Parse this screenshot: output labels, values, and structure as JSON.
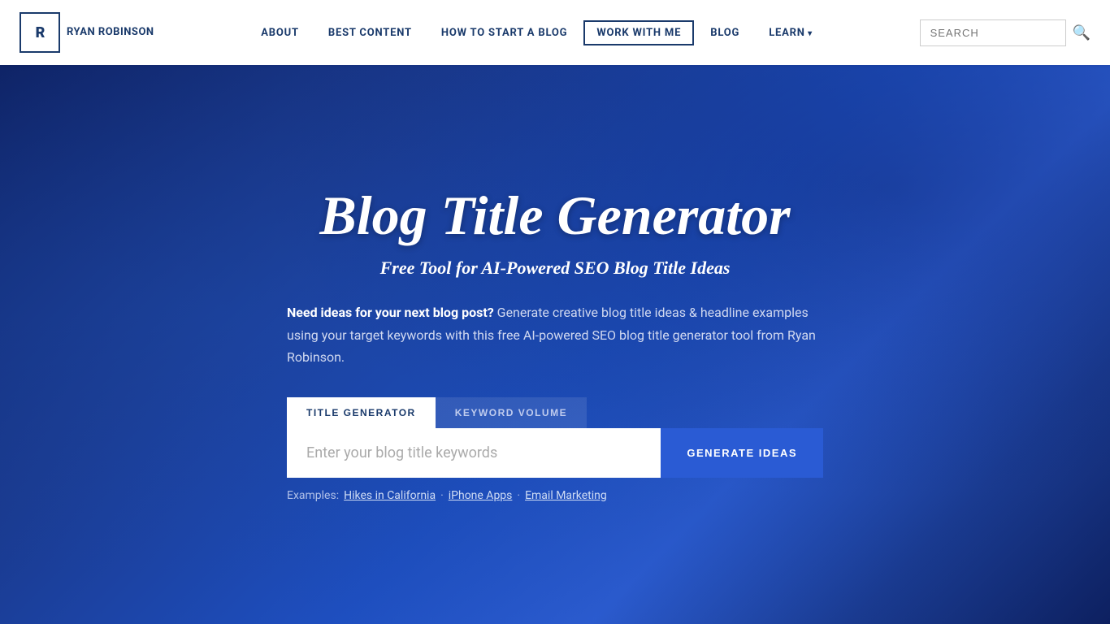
{
  "header": {
    "logo": {
      "initials": "R",
      "brand_name": "RYAN ROBINSON"
    },
    "nav": {
      "items": [
        {
          "id": "about",
          "label": "ABOUT",
          "active": false,
          "has_arrow": false
        },
        {
          "id": "best-content",
          "label": "BEST CONTENT",
          "active": false,
          "has_arrow": false
        },
        {
          "id": "how-to-start-a-blog",
          "label": "HOW TO START A BLOG",
          "active": false,
          "has_arrow": false
        },
        {
          "id": "work-with-me",
          "label": "WORK WITH ME",
          "active": true,
          "has_arrow": false
        },
        {
          "id": "blog",
          "label": "BLOG",
          "active": false,
          "has_arrow": false
        },
        {
          "id": "learn",
          "label": "LEARN",
          "active": false,
          "has_arrow": true
        }
      ]
    },
    "search": {
      "placeholder": "SEARCH"
    }
  },
  "hero": {
    "title": "Blog Title Generator",
    "subtitle": "Free Tool for AI-Powered SEO Blog Title Ideas",
    "description_bold": "Need ideas for your next blog post?",
    "description_text": " Generate creative blog title ideas & headline examples using your target keywords with this free AI-powered SEO blog title generator tool from Ryan Robinson.",
    "tabs": [
      {
        "id": "title-generator",
        "label": "TITLE GENERATOR",
        "active": true
      },
      {
        "id": "keyword-volume",
        "label": "KEYWORD VOLUME",
        "active": false
      }
    ],
    "input": {
      "placeholder": "Enter your blog title keywords"
    },
    "generate_button": "GENERATE IDEAS",
    "examples": {
      "label": "Examples:",
      "items": [
        {
          "text": "Hikes in California",
          "separator": ""
        },
        {
          "text": "iPhone Apps",
          "separator": ""
        },
        {
          "text": "Email Marketing",
          "separator": ""
        }
      ]
    }
  }
}
